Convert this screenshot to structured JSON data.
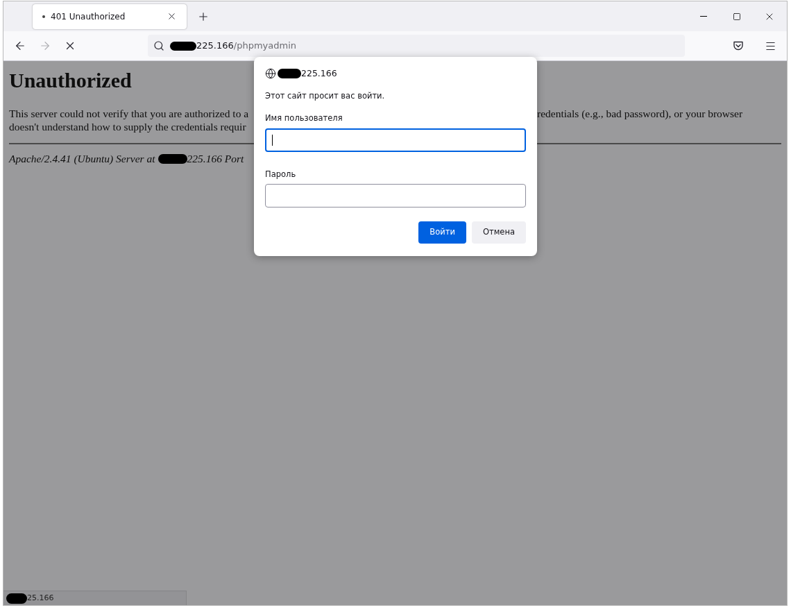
{
  "tabs": [
    {
      "title": "401 Unauthorized",
      "selected": true
    }
  ],
  "nav_buttons": [
    {
      "kind": "back",
      "disabled": false
    },
    {
      "kind": "forward",
      "disabled": true
    },
    {
      "kind": "stop",
      "disabled": false
    }
  ],
  "address": {
    "host": "225.166",
    "path": "/phpmyadmin"
  },
  "page": {
    "heading": "Unauthorized",
    "paragraph_lines": [
      {
        "left": "This server could not verify that you are authorized to a",
        "right": "redentials (e.g., bad password), or your browser"
      },
      {
        "left": "doesn't understand how to supply the credentials requir"
      }
    ],
    "footer_before": "Apache/2.4.41 (Ubuntu) Server at",
    "footer_after": "225.166 Port"
  },
  "dialog": {
    "host": "225.166",
    "message": "Этот сайт просит вас войти.",
    "fields": [
      {
        "label": "Имя пользователя",
        "focused": true
      },
      {
        "label": "Пароль",
        "focused": false
      }
    ],
    "buttons": [
      {
        "label": "Войти",
        "kind": "primary"
      },
      {
        "label": "Отмена",
        "kind": "secondary"
      }
    ]
  },
  "status_bar": "25.166"
}
